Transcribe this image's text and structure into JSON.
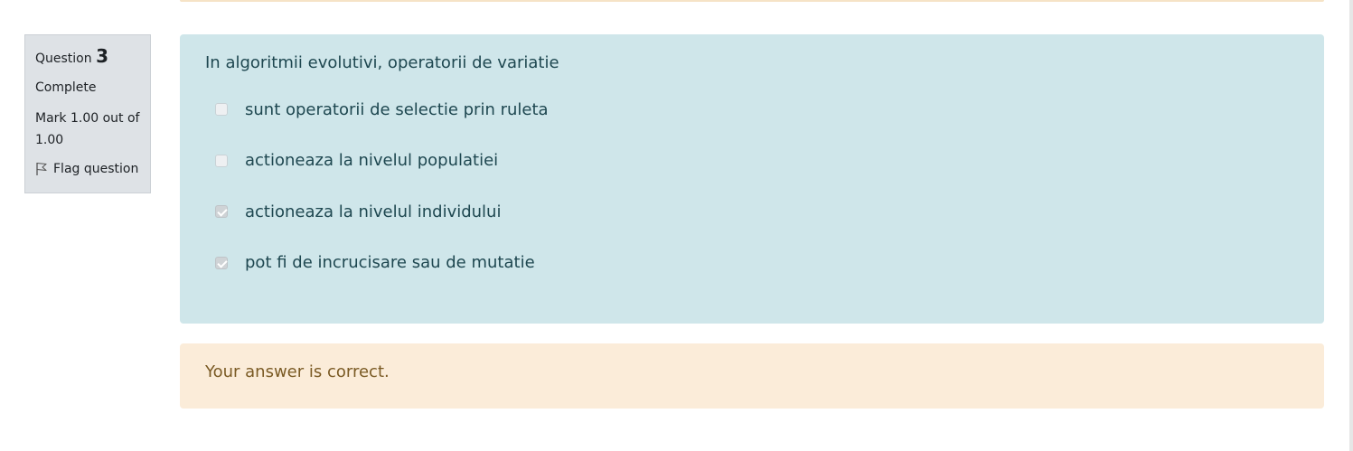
{
  "question": {
    "prefix": "Question",
    "number": "3",
    "state": "Complete",
    "grade": "Mark 1.00 out of 1.00",
    "flag_label": "Flag question",
    "flag_icon": "flag-icon",
    "text": "In algoritmii evolutivi, operatorii de variatie"
  },
  "answers": [
    {
      "label": "sunt operatorii de selectie prin ruleta",
      "checked": false
    },
    {
      "label": "actioneaza la nivelul populatiei",
      "checked": false
    },
    {
      "label": "actioneaza la nivelul individului",
      "checked": true
    },
    {
      "label": "pot fi de incrucisare sau de mutatie",
      "checked": true
    }
  ],
  "feedback": {
    "text": "Your answer is correct."
  },
  "colors": {
    "formulation_bg": "#cfe6ea",
    "feedback_bg": "#fbecd9",
    "info_bg": "#dee2e6"
  }
}
